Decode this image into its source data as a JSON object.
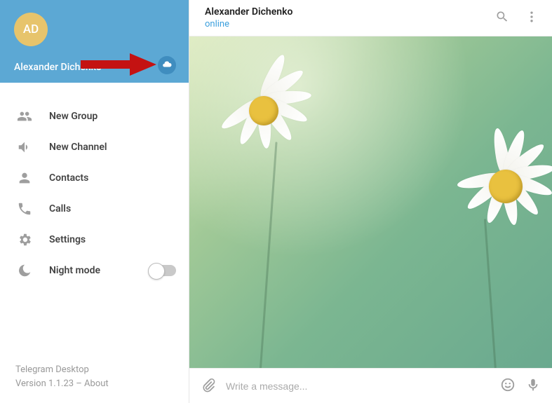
{
  "sidebar": {
    "avatar_initials": "AD",
    "username": "Alexander Dichenko",
    "menu": [
      {
        "label": "New Group",
        "icon": "group-icon"
      },
      {
        "label": "New Channel",
        "icon": "channel-icon"
      },
      {
        "label": "Contacts",
        "icon": "contacts-icon"
      },
      {
        "label": "Calls",
        "icon": "calls-icon"
      },
      {
        "label": "Settings",
        "icon": "settings-icon"
      },
      {
        "label": "Night mode",
        "icon": "night-icon",
        "toggle": false
      }
    ],
    "footer": {
      "app_name": "Telegram Desktop",
      "version_line": "Version 1.1.23 – About"
    }
  },
  "chat": {
    "title": "Alexander Dichenko",
    "status": "online",
    "message_placeholder": "Write a message..."
  },
  "colors": {
    "accent": "#5ca8d4",
    "link": "#3ca0dd",
    "avatar_bg": "#e7c46c"
  }
}
